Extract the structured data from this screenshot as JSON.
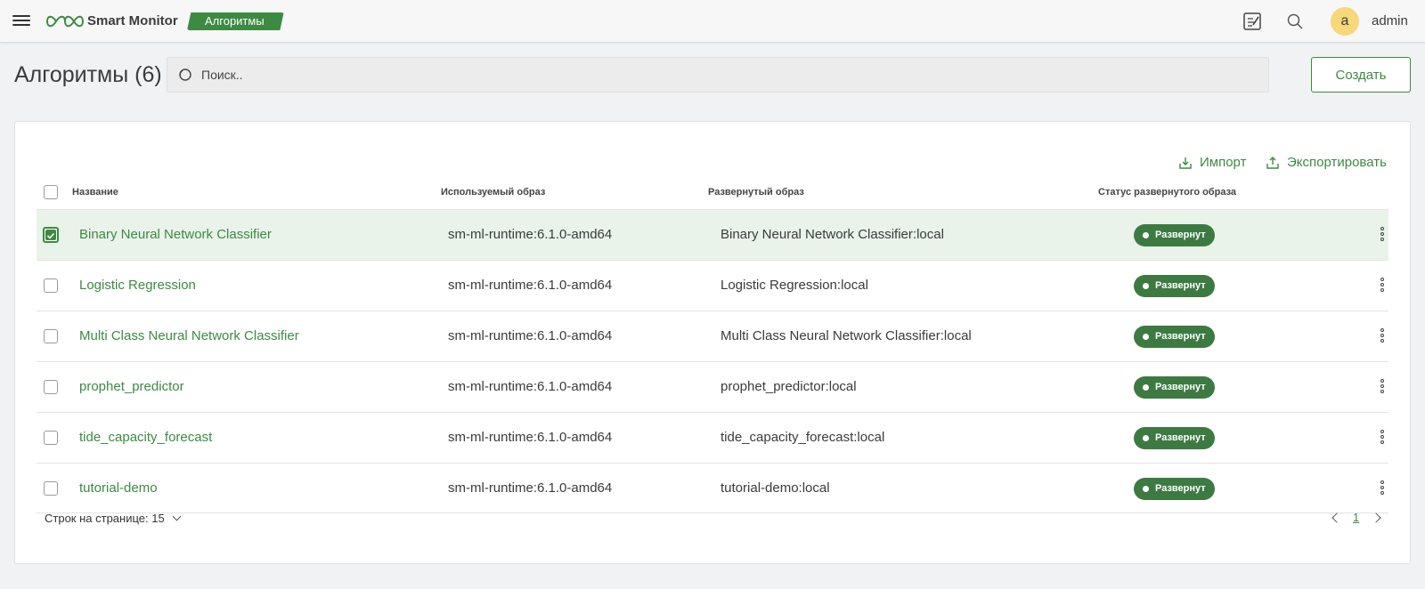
{
  "app": {
    "name": "Smart Monitor",
    "breadcrumb": "Алгоритмы"
  },
  "header": {
    "user_initial": "a",
    "username": "admin"
  },
  "page": {
    "title": "Алгоритмы (6)",
    "search_placeholder": "Поиск..",
    "create_label": "Создать"
  },
  "actions": {
    "import_label": "Импорт",
    "export_label": "Экспортировать"
  },
  "table": {
    "columns": [
      "Название",
      "Используемый образ",
      "Развернутый образ",
      "Статус развернутого образа"
    ],
    "rows": [
      {
        "name": "Binary Neural Network Classifier",
        "image": "sm-ml-runtime:6.1.0-amd64",
        "deployed": "Binary Neural Network Classifier:local",
        "status": "Развернут",
        "selected": true
      },
      {
        "name": "Logistic Regression",
        "image": "sm-ml-runtime:6.1.0-amd64",
        "deployed": "Logistic Regression:local",
        "status": "Развернут",
        "selected": false
      },
      {
        "name": "Multi Class Neural Network Classifier",
        "image": "sm-ml-runtime:6.1.0-amd64",
        "deployed": "Multi Class Neural Network Classifier:local",
        "status": "Развернут",
        "selected": false
      },
      {
        "name": "prophet_predictor",
        "image": "sm-ml-runtime:6.1.0-amd64",
        "deployed": "prophet_predictor:local",
        "status": "Развернут",
        "selected": false
      },
      {
        "name": "tide_capacity_forecast",
        "image": "sm-ml-runtime:6.1.0-amd64",
        "deployed": "tide_capacity_forecast:local",
        "status": "Развернут",
        "selected": false
      },
      {
        "name": "tutorial-demo",
        "image": "sm-ml-runtime:6.1.0-amd64",
        "deployed": "tutorial-demo:local",
        "status": "Развернут",
        "selected": false
      }
    ]
  },
  "footer": {
    "rows_per_page": "Строк на странице: 15",
    "current_page": "1"
  },
  "colors": {
    "accent": "#3d8a43",
    "status": "#3d7a42",
    "selected_row": "#e9f3ea",
    "avatar": "#f6d77a"
  },
  "icons": [
    "menu-icon",
    "logo-icon",
    "notes-icon",
    "search-icon",
    "import-icon",
    "export-icon",
    "kebab-icon",
    "chevron-down-icon",
    "chevron-left-icon",
    "chevron-right-icon"
  ]
}
